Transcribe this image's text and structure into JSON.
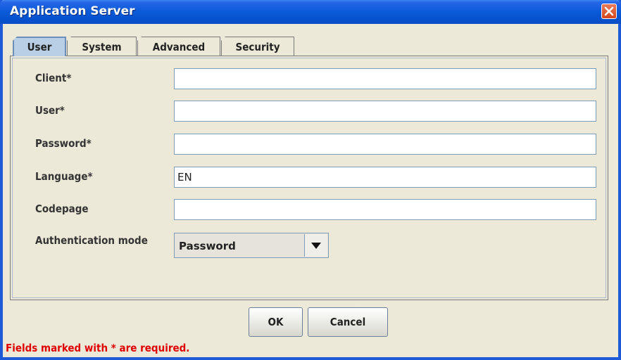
{
  "window": {
    "title": "Application Server",
    "close_icon": "close-icon"
  },
  "tabs": [
    {
      "label": "User",
      "active": true
    },
    {
      "label": "System",
      "active": false
    },
    {
      "label": "Advanced",
      "active": false
    },
    {
      "label": "Security",
      "active": false
    }
  ],
  "form": {
    "client": {
      "label": "Client*",
      "value": ""
    },
    "user": {
      "label": "User*",
      "value": ""
    },
    "password": {
      "label": "Password*",
      "value": ""
    },
    "language": {
      "label": "Language*",
      "value": "EN"
    },
    "codepage": {
      "label": "Codepage",
      "value": ""
    },
    "auth_mode": {
      "label": "Authentication mode",
      "value": "Password",
      "arrow_icon": "triangle-down-icon"
    }
  },
  "buttons": {
    "ok": "OK",
    "cancel": "Cancel"
  },
  "footer": {
    "required_note": "Fields marked with * are required."
  },
  "colors": {
    "title_bar": "#0a5ad8",
    "active_tab": "#b8cfe5",
    "required_note": "#e00000"
  }
}
